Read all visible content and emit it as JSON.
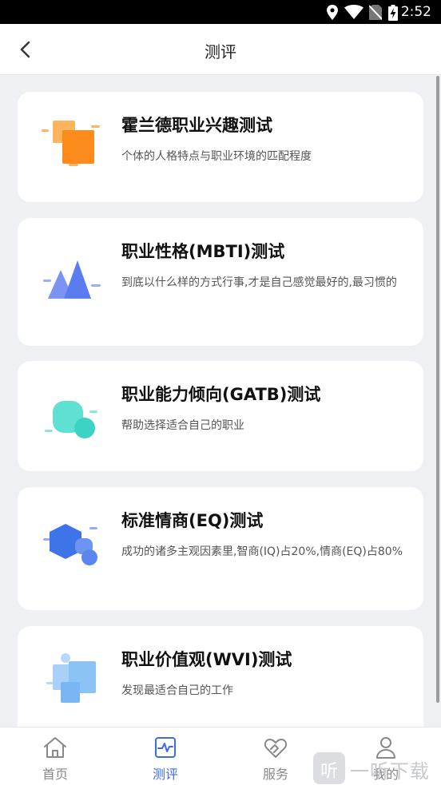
{
  "status_bar": {
    "time": "2:52",
    "icons": [
      "location-icon",
      "wifi-icon",
      "no-sim-icon",
      "battery-charging-icon"
    ]
  },
  "header": {
    "title": "测评",
    "back_icon": "chevron-left-icon"
  },
  "cards": [
    {
      "title": "霍兰德职业兴趣测试",
      "description": "个体的人格特点与职业环境的匹配程度",
      "icon": "orange-squares-icon",
      "color": "#fb8c1c"
    },
    {
      "title": "职业性格(MBTI)测试",
      "description": "到底以什么样的方式行事,才是自己感觉最好的,最习惯的",
      "icon": "blue-mountains-icon",
      "color": "#5b7cf0"
    },
    {
      "title": "职业能力倾向(GATB)测试",
      "description": "帮助选择适合自己的职业",
      "icon": "teal-bubbles-icon",
      "color": "#3cd2c4"
    },
    {
      "title": "标准情商(EQ)测试",
      "description": "成功的诸多主观因素里,智商(IQ)占20%,情商(EQ)占80%",
      "icon": "blue-hexagon-icon",
      "color": "#3f74e8"
    },
    {
      "title": "职业价值观(WVI)测试",
      "description": "发现最适合自己的工作",
      "icon": "light-blue-blocks-icon",
      "color": "#8cc3f5"
    }
  ],
  "tabs": [
    {
      "label": "首页",
      "icon": "home-icon",
      "active": false
    },
    {
      "label": "测评",
      "icon": "pulse-chart-icon",
      "active": true
    },
    {
      "label": "服务",
      "icon": "handshake-icon",
      "active": false
    },
    {
      "label": "我的",
      "icon": "user-icon",
      "active": false
    }
  ],
  "colors": {
    "accent": "#3c6de0",
    "background": "#eef0f4",
    "tab_inactive": "#888888"
  },
  "watermark": {
    "badge": "听",
    "text": "一听下载"
  }
}
